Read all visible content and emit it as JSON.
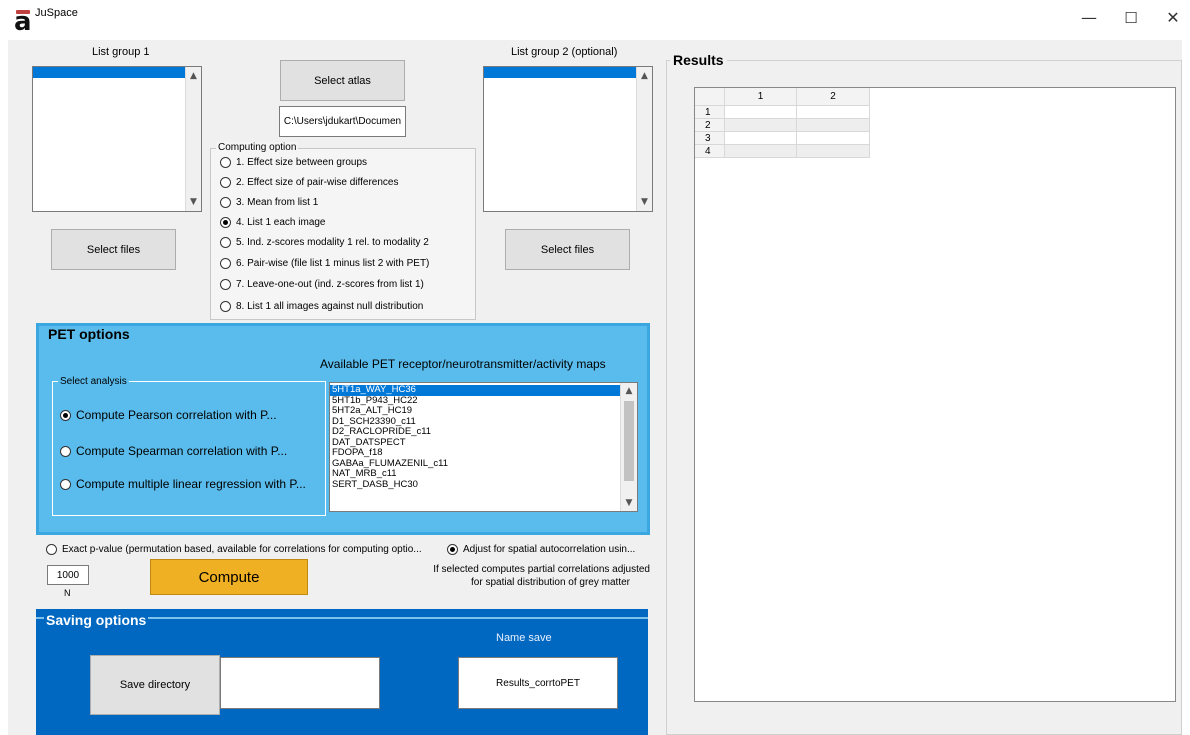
{
  "window": {
    "title": "JuSpace",
    "icon_letter": "a",
    "controls": {
      "minimize": "—",
      "maximize": "☐",
      "close": "✕"
    }
  },
  "list_group_1": {
    "label": "List group 1",
    "select_files_label": "Select files"
  },
  "list_group_2": {
    "label": "List group 2 (optional)",
    "select_files_label": "Select files"
  },
  "atlas": {
    "select_label": "Select atlas",
    "path_value": "C:\\Users\\jdukart\\Documen"
  },
  "computing_option": {
    "legend": "Computing option",
    "options": [
      {
        "label": "1. Effect size between groups",
        "selected": false
      },
      {
        "label": "2. Effect size of pair-wise differences",
        "selected": false
      },
      {
        "label": "3. Mean from list 1",
        "selected": false
      },
      {
        "label": "4. List 1 each image",
        "selected": true
      },
      {
        "label": "5. Ind. z-scores modality 1 rel. to modality 2",
        "selected": false
      },
      {
        "label": "6. Pair-wise (file list 1 minus list 2 with PET)",
        "selected": false
      },
      {
        "label": "7. Leave-one-out (ind. z-scores from list 1)",
        "selected": false
      },
      {
        "label": "8. List 1  all images against null distribution",
        "selected": false
      }
    ]
  },
  "pet_options": {
    "legend": "PET options",
    "available_label": "Available PET receptor/neurotransmitter/activity maps",
    "analysis_legend": "Select analysis",
    "analysis_options": [
      {
        "label": "Compute Pearson correlation with P...",
        "selected": true
      },
      {
        "label": "Compute Spearman correlation with P...",
        "selected": false
      },
      {
        "label": "Compute multiple linear regression with P...",
        "selected": false
      }
    ],
    "maps": [
      {
        "label": "5HT1a_WAY_HC36",
        "selected": true
      },
      {
        "label": "5HT1b_P943_HC22",
        "selected": false
      },
      {
        "label": "5HT2a_ALT_HC19",
        "selected": false
      },
      {
        "label": "D1_SCH23390_c11",
        "selected": false
      },
      {
        "label": "D2_RACLOPRIDE_c11",
        "selected": false
      },
      {
        "label": "DAT_DATSPECT",
        "selected": false
      },
      {
        "label": "FDOPA_f18",
        "selected": false
      },
      {
        "label": "GABAa_FLUMAZENIL_c11",
        "selected": false
      },
      {
        "label": "NAT_MRB_c11",
        "selected": false
      },
      {
        "label": "SERT_DASB_HC30",
        "selected": false
      }
    ]
  },
  "compute_section": {
    "exact_p_label": "Exact p-value (permutation based, available for correlations for computing optio...",
    "exact_p_selected": false,
    "adjust_label": "Adjust for spatial autocorrelation usin...",
    "adjust_selected": true,
    "n_value": "1000",
    "n_label": "N",
    "compute_label": "Compute",
    "note_line1": "If selected computes partial correlations adjusted",
    "note_line2": "for spatial distribution of grey matter"
  },
  "saving_options": {
    "legend": "Saving options",
    "name_save_label": "Name save",
    "save_directory_label": "Save directory",
    "directory_value": "",
    "name_value": "Results_corrtoPET"
  },
  "results": {
    "legend": "Results",
    "column_headers": [
      "1",
      "2"
    ],
    "row_headers": [
      "1",
      "2",
      "3",
      "4"
    ]
  },
  "colors": {
    "pet_panel": "#5abcec",
    "save_panel": "#0068c0",
    "compute_button": "#f0b023",
    "selection": "#0078d7"
  }
}
